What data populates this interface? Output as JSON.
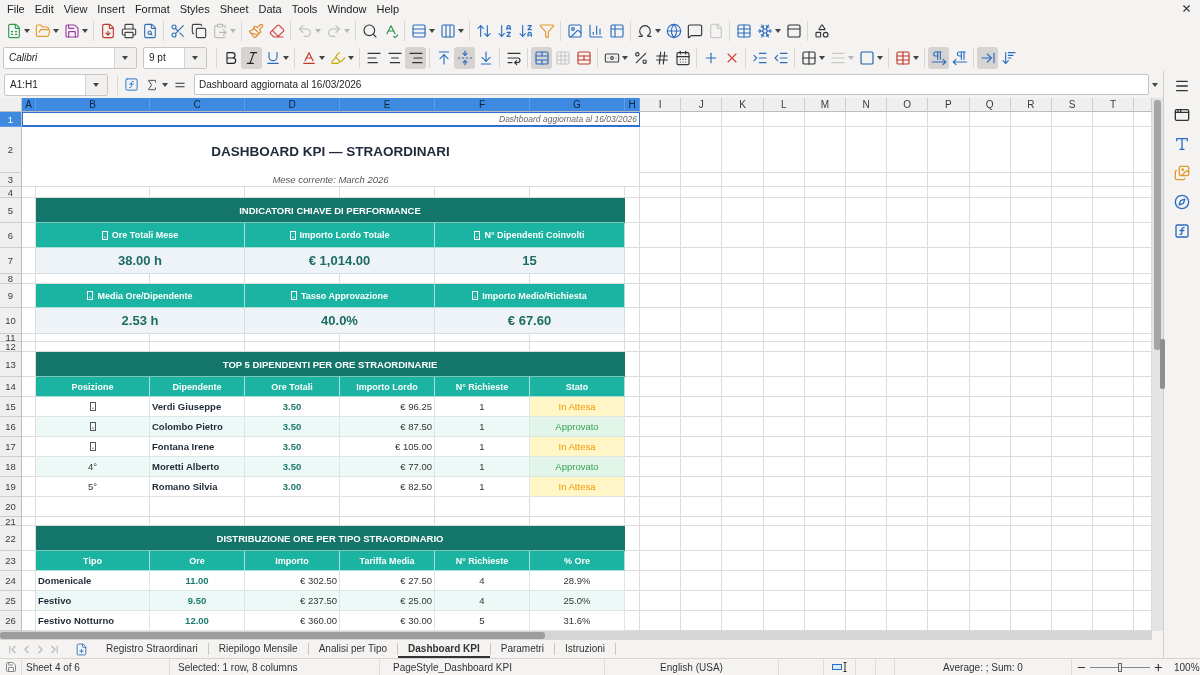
{
  "menu_bar": {
    "items": [
      "File",
      "Edit",
      "View",
      "Insert",
      "Format",
      "Styles",
      "Sheet",
      "Data",
      "Tools",
      "Window",
      "Help"
    ]
  },
  "standard_toolbar": {
    "buttons": [
      {
        "pressed": false,
        "disabled": false
      },
      {
        "pressed": false,
        "disabled": false
      },
      {
        "pressed": false,
        "disabled": false
      },
      {
        "pressed": false,
        "disabled": false
      },
      {
        "pressed": false,
        "disabled": false
      },
      {
        "pressed": false,
        "disabled": false
      },
      {
        "pressed": false,
        "disabled": false
      },
      {
        "pressed": false,
        "disabled": false
      },
      {
        "pressed": false,
        "disabled": true
      },
      {
        "pressed": false,
        "disabled": false
      },
      {
        "pressed": false,
        "disabled": false
      },
      {
        "pressed": false,
        "disabled": true
      },
      {
        "pressed": false,
        "disabled": true
      },
      {
        "pressed": false,
        "disabled": false
      },
      {
        "pressed": false,
        "disabled": false
      },
      {
        "pressed": false,
        "disabled": false
      },
      {
        "pressed": false,
        "disabled": false
      },
      {
        "pressed": false,
        "disabled": false
      },
      {
        "pressed": false,
        "disabled": false
      },
      {
        "pressed": false,
        "disabled": false
      },
      {
        "pressed": false,
        "disabled": false
      },
      {
        "pressed": false,
        "disabled": false
      },
      {
        "pressed": false,
        "disabled": false
      },
      {
        "pressed": false,
        "disabled": false
      },
      {
        "pressed": false,
        "disabled": false
      },
      {
        "pressed": false,
        "disabled": false
      },
      {
        "pressed": false,
        "disabled": false
      },
      {
        "pressed": false,
        "disabled": true
      },
      {
        "pressed": false,
        "disabled": false
      },
      {
        "pressed": false,
        "disabled": false
      },
      {
        "pressed": false,
        "disabled": false
      },
      {
        "pressed": false,
        "disabled": false
      }
    ]
  },
  "formatting_toolbar": {
    "font_name": "Calibri",
    "font_size": "9 pt",
    "buttons": [
      {
        "pressed": false,
        "disabled": false
      },
      {
        "pressed": true,
        "disabled": false
      },
      {
        "pressed": false,
        "disabled": false
      },
      {
        "pressed": false,
        "disabled": false
      },
      {
        "pressed": false,
        "disabled": false
      },
      {
        "pressed": false,
        "disabled": false
      },
      {
        "pressed": false,
        "disabled": false
      },
      {
        "pressed": true,
        "disabled": false
      },
      {
        "pressed": false,
        "disabled": false
      },
      {
        "pressed": true,
        "disabled": false
      },
      {
        "pressed": false,
        "disabled": false
      },
      {
        "pressed": false,
        "disabled": false
      },
      {
        "pressed": true,
        "disabled": false
      },
      {
        "pressed": false,
        "disabled": true
      },
      {
        "pressed": false,
        "disabled": false
      },
      {
        "pressed": false,
        "disabled": false
      },
      {
        "pressed": false,
        "disabled": false
      },
      {
        "pressed": false,
        "disabled": false
      },
      {
        "pressed": false,
        "disabled": false
      },
      {
        "pressed": false,
        "disabled": false
      },
      {
        "pressed": false,
        "disabled": false
      },
      {
        "pressed": false,
        "disabled": false
      },
      {
        "pressed": false,
        "disabled": false
      },
      {
        "pressed": false,
        "disabled": false
      },
      {
        "pressed": false,
        "disabled": true
      },
      {
        "pressed": false,
        "disabled": false
      },
      {
        "pressed": false,
        "disabled": false
      },
      {
        "pressed": true,
        "disabled": false
      },
      {
        "pressed": false,
        "disabled": false
      },
      {
        "pressed": true,
        "disabled": false
      },
      {
        "pressed": false,
        "disabled": false
      }
    ]
  },
  "formula_bar": {
    "name_box": "A1:H1",
    "content": "Dashboard aggiornata al 16/03/2026"
  },
  "sheet": {
    "columns": [
      {
        "label": "A",
        "selected": true
      },
      {
        "label": "B",
        "selected": true
      },
      {
        "label": "C",
        "selected": true
      },
      {
        "label": "D",
        "selected": true
      },
      {
        "label": "E",
        "selected": true
      },
      {
        "label": "F",
        "selected": true
      },
      {
        "label": "G",
        "selected": true
      },
      {
        "label": "H",
        "selected": true
      },
      {
        "label": "I",
        "selected": false
      },
      {
        "label": "J",
        "selected": false
      },
      {
        "label": "K",
        "selected": false
      },
      {
        "label": "L",
        "selected": false
      },
      {
        "label": "M",
        "selected": false
      },
      {
        "label": "N",
        "selected": false
      },
      {
        "label": "O",
        "selected": false
      },
      {
        "label": "P",
        "selected": false
      },
      {
        "label": "Q",
        "selected": false
      },
      {
        "label": "R",
        "selected": false
      },
      {
        "label": "S",
        "selected": false
      },
      {
        "label": "T",
        "selected": false
      }
    ],
    "rows": [
      {
        "label": "1",
        "selected": true
      },
      {
        "label": "2",
        "selected": false
      },
      {
        "label": "3",
        "selected": false
      },
      {
        "label": "4",
        "selected": false
      },
      {
        "label": "5",
        "selected": false
      },
      {
        "label": "6",
        "selected": false
      },
      {
        "label": "7",
        "selected": false
      },
      {
        "label": "8",
        "selected": false
      },
      {
        "label": "9",
        "selected": false
      },
      {
        "label": "10",
        "selected": false
      },
      {
        "label": "11",
        "selected": false
      },
      {
        "label": "12",
        "selected": false
      },
      {
        "label": "13",
        "selected": false
      },
      {
        "label": "14",
        "selected": false
      },
      {
        "label": "15",
        "selected": false
      },
      {
        "label": "16",
        "selected": false
      },
      {
        "label": "17",
        "selected": false
      },
      {
        "label": "18",
        "selected": false
      },
      {
        "label": "19",
        "selected": false
      },
      {
        "label": "20",
        "selected": false
      },
      {
        "label": "21",
        "selected": false
      },
      {
        "label": "22",
        "selected": false
      },
      {
        "label": "23",
        "selected": false
      },
      {
        "label": "24",
        "selected": false
      },
      {
        "label": "25",
        "selected": false
      },
      {
        "label": "26",
        "selected": false
      }
    ],
    "updated_note": "Dashboard aggiornata al 16/03/2026",
    "title": "DASHBOARD KPI — STRAORDINARI",
    "subtitle": "Mese corrente: March 2026",
    "kpi_section": {
      "title": "INDICATORI CHIAVE DI PERFORMANCE",
      "cards": [
        {
          "label": "Ore Totali Mese",
          "value": "38.00 h"
        },
        {
          "label": "Importo Lordo Totale",
          "value": "€ 1,014.00"
        },
        {
          "label": "N° Dipendenti Coinvolti",
          "value": "15"
        },
        {
          "label": "Media Ore/Dipendente",
          "value": "2.53 h"
        },
        {
          "label": "Tasso Approvazione",
          "value": "40.0%"
        },
        {
          "label": "Importo Medio/Richiesta",
          "value": "€ 67.60"
        }
      ]
    },
    "top_employees": {
      "title": "TOP 5 DIPENDENTI PER ORE STRAORDINARIE",
      "columns": [
        "Posizione",
        "Dipendente",
        "Ore Totali",
        "Importo Lordo",
        "N° Richieste",
        "Stato"
      ],
      "rows": [
        {
          "position": {
            "kind": "glyph"
          },
          "employee": "Verdi Giuseppe",
          "hours": "3.50",
          "amount": "€ 96.25",
          "requests": "1",
          "status": {
            "text": "In Attesa",
            "kind": "pending"
          }
        },
        {
          "position": {
            "kind": "glyph"
          },
          "employee": "Colombo Pietro",
          "hours": "3.50",
          "amount": "€ 87.50",
          "requests": "1",
          "status": {
            "text": "Approvato",
            "kind": "approved"
          }
        },
        {
          "position": {
            "kind": "glyph"
          },
          "employee": "Fontana Irene",
          "hours": "3.50",
          "amount": "€ 105.00",
          "requests": "1",
          "status": {
            "text": "In Attesa",
            "kind": "pending"
          }
        },
        {
          "position": {
            "kind": "text",
            "text": "4°"
          },
          "employee": "Moretti Alberto",
          "hours": "3.50",
          "amount": "€ 77.00",
          "requests": "1",
          "status": {
            "text": "Approvato",
            "kind": "approved"
          }
        },
        {
          "position": {
            "kind": "text",
            "text": "5°"
          },
          "employee": "Romano Silvia",
          "hours": "3.00",
          "amount": "€ 82.50",
          "requests": "1",
          "status": {
            "text": "In Attesa",
            "kind": "pending"
          }
        }
      ]
    },
    "distribution": {
      "title": "DISTRIBUZIONE ORE PER TIPO STRAORDINARIO",
      "columns": [
        "Tipo",
        "Ore",
        "Importo",
        "Tariffa Media",
        "N° Richieste",
        "% Ore"
      ],
      "rows": [
        {
          "type": "Domenicale",
          "hours": "11.00",
          "amount": "€ 302.50",
          "average_rate": "€ 27.50",
          "requests": "4",
          "share": "28.9%"
        },
        {
          "type": "Festivo",
          "hours": "9.50",
          "amount": "€ 237.50",
          "average_rate": "€ 25.00",
          "requests": "4",
          "share": "25.0%"
        },
        {
          "type": "Festivo Notturno",
          "hours": "12.00",
          "amount": "€ 360.00",
          "average_rate": "€ 30.00",
          "requests": "5",
          "share": "31.6%"
        }
      ]
    }
  },
  "sheet_tabs": [
    {
      "label": "Registro Straordinari",
      "selected": false
    },
    {
      "label": "Riepilogo Mensile",
      "selected": false
    },
    {
      "label": "Analisi per Tipo",
      "selected": false
    },
    {
      "label": "Dashboard KPI",
      "selected": true
    },
    {
      "label": "Parametri",
      "selected": false
    },
    {
      "label": "Istruzioni",
      "selected": false
    }
  ],
  "status_bar": {
    "sheet": "Sheet 4 of 6",
    "selection": "Selected: 1 row, 8 columns",
    "page_style": "PageStyle_Dashboard KPI",
    "language": "English (USA)",
    "summary": "Average: ; Sum: 0",
    "zoom": {
      "level": 0.5,
      "reading": "100%"
    }
  }
}
